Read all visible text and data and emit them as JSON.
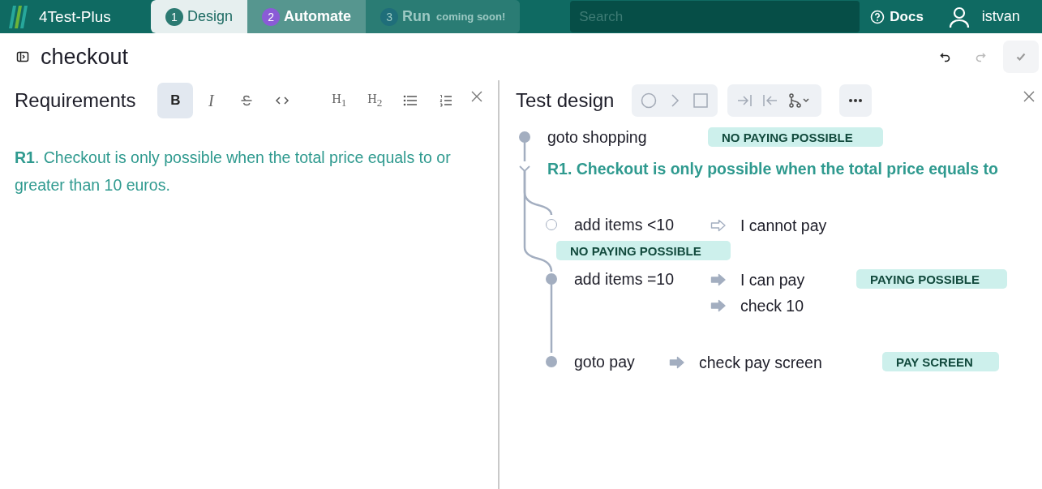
{
  "header": {
    "logo": "4Test-Plus",
    "tabs": [
      {
        "number": "1",
        "label": "Design",
        "selected": true,
        "disabled": false,
        "color": "#2b7a72"
      },
      {
        "number": "2",
        "label": "Automate",
        "selected": false,
        "disabled": false,
        "color": "#8a5bd6"
      },
      {
        "number": "3",
        "label": "Run",
        "note": "coming soon!",
        "selected": false,
        "disabled": true,
        "color": "#1f6e7a"
      }
    ],
    "search": {
      "placeholder": "Search"
    },
    "docs": "Docs",
    "user": "istvan"
  },
  "page": {
    "title": "checkout",
    "actions": [
      {
        "kind": "undo",
        "disabled": false
      },
      {
        "kind": "redo",
        "disabled": true
      },
      {
        "kind": "confirm",
        "disabled": true
      }
    ]
  },
  "requirements": {
    "title": "Requirements",
    "toolbar": [
      {
        "kind": "bold",
        "label": "B",
        "selected": true
      },
      {
        "kind": "italic",
        "label": "I",
        "selected": false
      },
      {
        "kind": "strike",
        "selected": false
      },
      {
        "kind": "code",
        "selected": false
      },
      {
        "kind": "heading",
        "label": "H$_{1}$",
        "selected": false
      },
      {
        "kind": "heading",
        "label": "H$_{2}$",
        "selected": false
      },
      {
        "kind": "bullets",
        "selected": false
      },
      {
        "kind": "numbers",
        "selected": false
      }
    ],
    "text": "**R1**. Checkout is only possible when the total price equals to or greater than 10 euros."
  },
  "test_design": {
    "title": "Test design",
    "steps": [
      {
        "kind": "step",
        "active": true,
        "action": "goto shopping",
        "tag": "NO PAYING POSSIBLE"
      },
      {
        "kind": "requirement",
        "expanded": true,
        "text": "R1. Checkout is only possible when the total price equals to",
        "children": [
          {
            "active": false,
            "action": "add items <10",
            "tag_below": true,
            "results": [
              {
                "text": "I cannot pay",
                "active": false
              }
            ],
            "tag": "NO PAYING POSSIBLE"
          },
          {
            "active": true,
            "action": "add items =10",
            "tag_below": false,
            "results": [
              {
                "text": "I can pay",
                "active": true
              },
              {
                "text": "check 10",
                "active": true
              }
            ],
            "tag": "PAYING POSSIBLE"
          }
        ]
      },
      {
        "kind": "branch-step",
        "active": true,
        "action": "goto pay",
        "results": [
          {
            "text": "check pay screen",
            "active": true
          }
        ],
        "tag": "PAY SCREEN"
      }
    ]
  }
}
